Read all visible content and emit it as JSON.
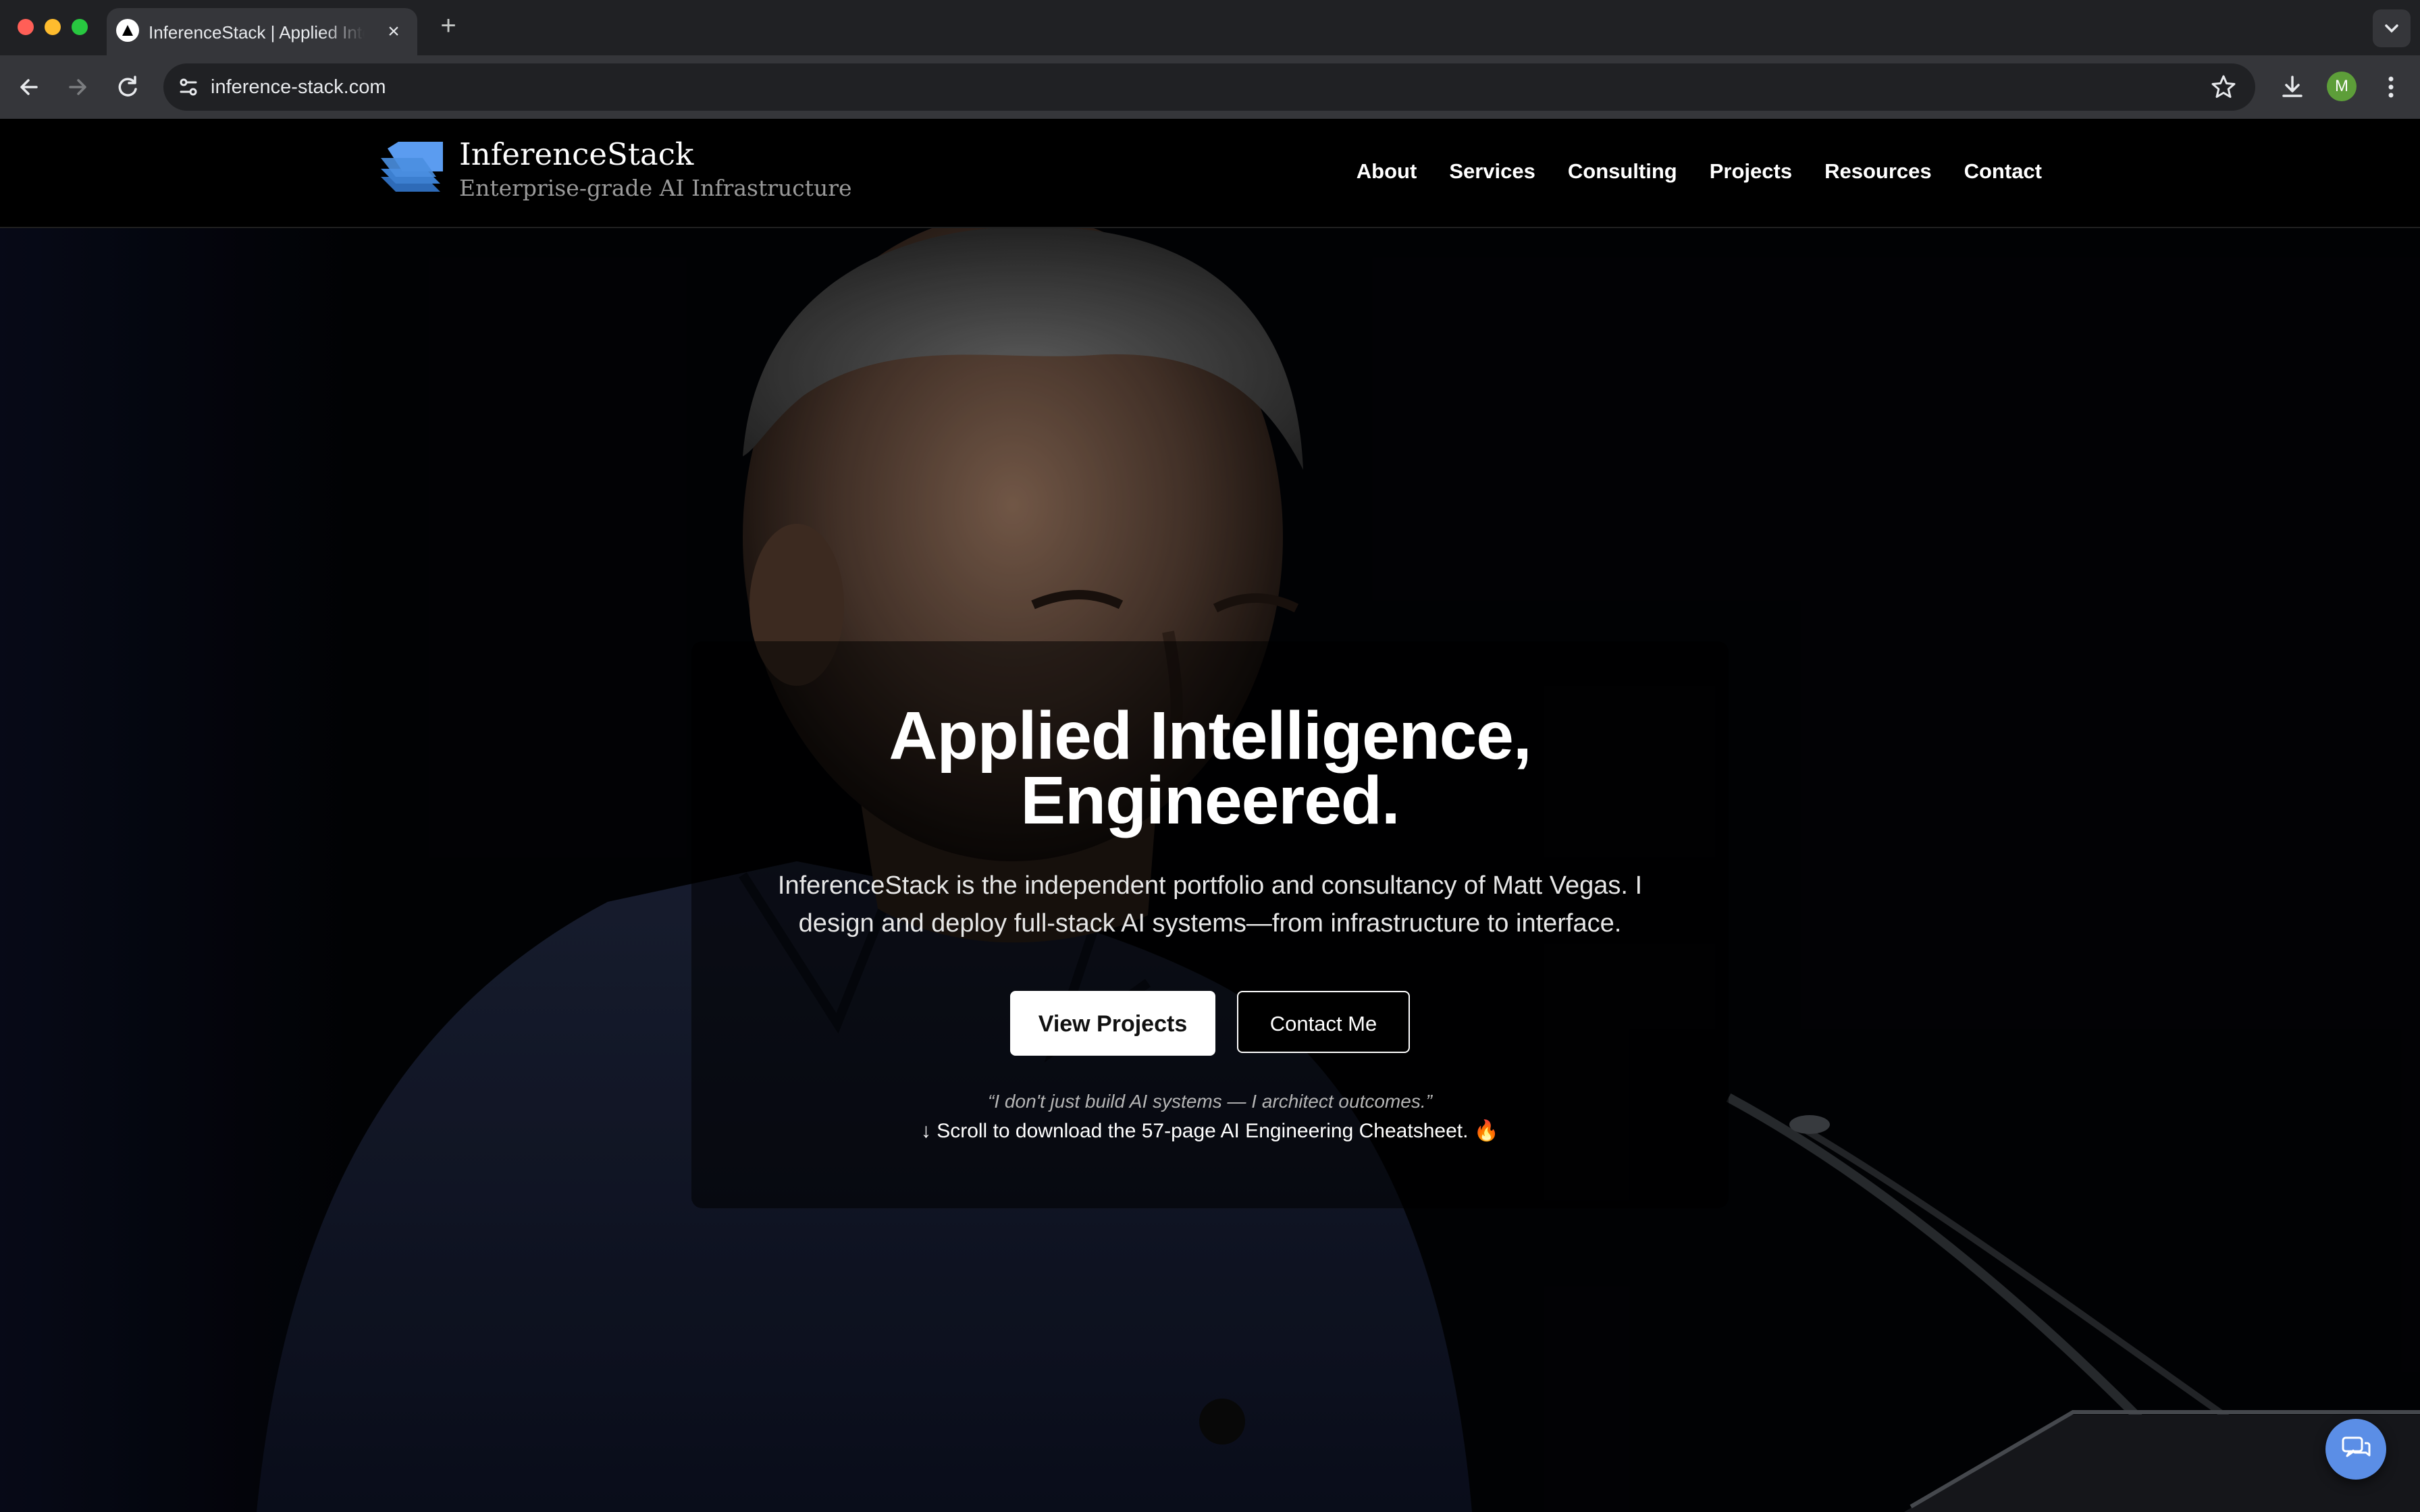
{
  "browser": {
    "tab_title": "InferenceStack | Applied Intelligence, Engineered.",
    "url": "inference-stack.com",
    "profile_initial": "M",
    "icons": [
      "back-icon",
      "forward-icon",
      "reload-icon",
      "site-info-icon",
      "star-icon",
      "download-icon",
      "more-icon",
      "new-tab-icon",
      "tab-close-icon"
    ]
  },
  "site": {
    "brand_name": "InferenceStack",
    "tagline": "Enterprise-grade AI Infrastructure",
    "nav": [
      "About",
      "Services",
      "Consulting",
      "Projects",
      "Resources",
      "Contact"
    ]
  },
  "hero": {
    "title_line1": "Applied Intelligence,",
    "title_line2": "Engineered.",
    "description": "InferenceStack is the independent portfolio and consultancy of Matt Vegas. I design and deploy full-stack AI systems—from infrastructure to interface.",
    "primary_button": "View Projects",
    "secondary_button": "Contact Me",
    "quote": "“I don't just build AI systems — I architect outcomes.”",
    "scroll_cta": "↓ Scroll to download the 57-page AI Engineering Cheatsheet. 🔥"
  },
  "colors": {
    "accent_blue": "#5b8ee6",
    "logo_blue": "#4a8fe0",
    "page_bg": "#000000",
    "chrome_bg": "#35363a",
    "profile_green": "#5d9e39"
  }
}
